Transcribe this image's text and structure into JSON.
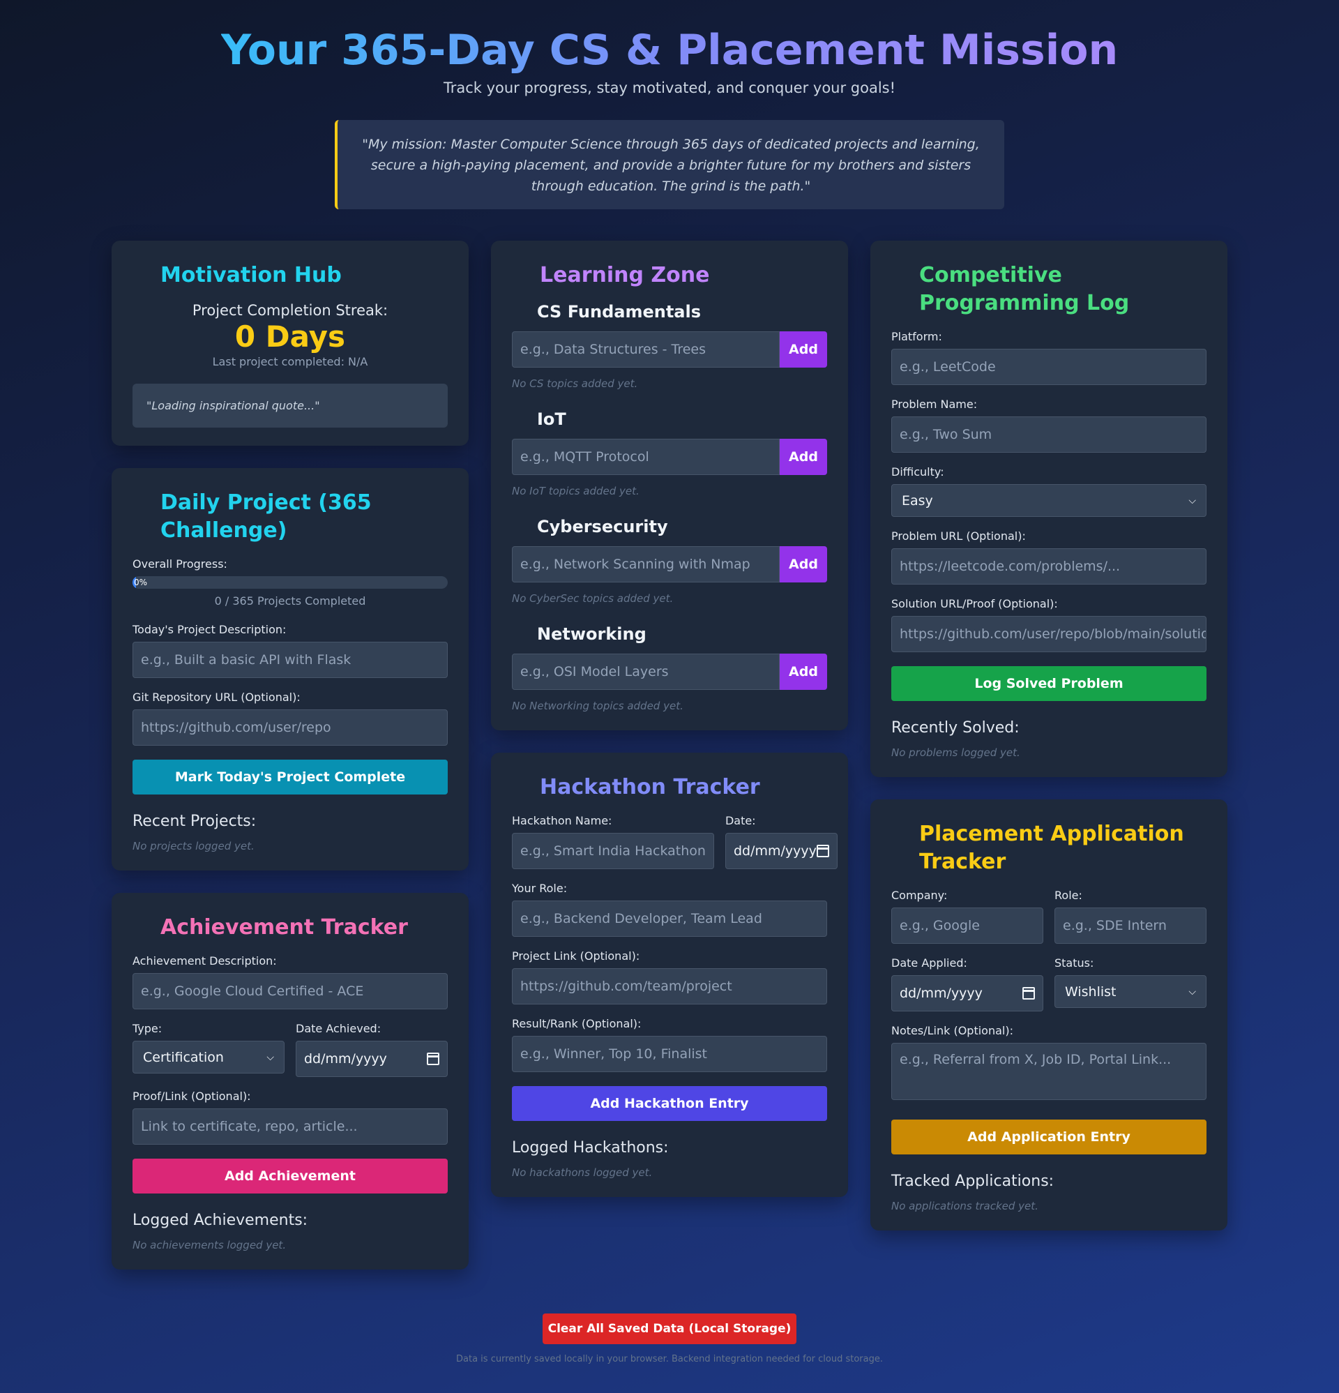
{
  "header": {
    "title": "Your 365-Day CS & Placement Mission",
    "subtitle": "Track your progress, stay motivated, and conquer your goals!",
    "mission": "\"My mission: Master Computer Science through 365 days of dedicated projects and learning, secure a high-paying placement, and provide a brighter future for my brothers and sisters through education. The grind is the path.\""
  },
  "motivation": {
    "title": "Motivation Hub",
    "streak_label": "Project Completion Streak:",
    "streak_value": "0 Days",
    "last_completed": "Last project completed: N/A",
    "quote": "\"Loading inspirational quote...\""
  },
  "daily": {
    "title": "Daily Project (365 Challenge)",
    "progress_label": "Overall Progress:",
    "progress_text": "0%",
    "progress_fraction": 0,
    "progress_caption": "0 / 365 Projects Completed",
    "desc_label": "Today's Project Description:",
    "desc_placeholder": "e.g., Built a basic API with Flask",
    "git_label": "Git Repository URL (Optional):",
    "git_placeholder": "https://github.com/user/repo",
    "button": "Mark Today's Project Complete",
    "recent_heading": "Recent Projects:",
    "recent_empty": "No projects logged yet.",
    "button_color": "#0891b2"
  },
  "achievement": {
    "title": "Achievement Tracker",
    "desc_label": "Achievement Description:",
    "desc_placeholder": "e.g., Google Cloud Certified - ACE",
    "type_label": "Type:",
    "type_value": "Certification",
    "date_label": "Date Achieved:",
    "date_placeholder": "dd/mm/yyyy",
    "proof_label": "Proof/Link (Optional):",
    "proof_placeholder": "Link to certificate, repo, article...",
    "button": "Add Achievement",
    "logged_heading": "Logged Achievements:",
    "logged_empty": "No achievements logged yet.",
    "button_color": "#db2777"
  },
  "learning": {
    "title": "Learning Zone",
    "add_label": "Add",
    "topics": [
      {
        "title": "CS Fundamentals",
        "placeholder": "e.g., Data Structures - Trees",
        "empty": "No CS topics added yet."
      },
      {
        "title": "IoT",
        "placeholder": "e.g., MQTT Protocol",
        "empty": "No IoT topics added yet."
      },
      {
        "title": "Cybersecurity",
        "placeholder": "e.g., Network Scanning with Nmap",
        "empty": "No CyberSec topics added yet."
      },
      {
        "title": "Networking",
        "placeholder": "e.g., OSI Model Layers",
        "empty": "No Networking topics added yet."
      }
    ]
  },
  "hackathon": {
    "title": "Hackathon Tracker",
    "name_label": "Hackathon Name:",
    "name_placeholder": "e.g., Smart India Hackathon",
    "date_label": "Date:",
    "date_placeholder": "dd/mm/yyyy",
    "role_label": "Your Role:",
    "role_placeholder": "e.g., Backend Developer, Team Lead",
    "link_label": "Project Link (Optional):",
    "link_placeholder": "https://github.com/team/project",
    "result_label": "Result/Rank (Optional):",
    "result_placeholder": "e.g., Winner, Top 10, Finalist",
    "button": "Add Hackathon Entry",
    "logged_heading": "Logged Hackathons:",
    "logged_empty": "No hackathons logged yet.",
    "button_color": "#4f46e5"
  },
  "cp": {
    "title": "Competitive Programming Log",
    "platform_label": "Platform:",
    "platform_placeholder": "e.g., LeetCode",
    "problem_label": "Problem Name:",
    "problem_placeholder": "e.g., Two Sum",
    "difficulty_label": "Difficulty:",
    "difficulty_value": "Easy",
    "url_label": "Problem URL (Optional):",
    "url_placeholder": "https://leetcode.com/problems/...",
    "solution_label": "Solution URL/Proof (Optional):",
    "solution_placeholder": "https://github.com/user/repo/blob/main/solution",
    "button": "Log Solved Problem",
    "recent_heading": "Recently Solved:",
    "recent_empty": "No problems logged yet.",
    "button_color": "#16a34a"
  },
  "placement": {
    "title": "Placement Application Tracker",
    "company_label": "Company:",
    "company_placeholder": "e.g., Google",
    "role_label": "Role:",
    "role_placeholder": "e.g., SDE Intern",
    "date_label": "Date Applied:",
    "date_placeholder": "dd/mm/yyyy",
    "status_label": "Status:",
    "status_value": "Wishlist",
    "notes_label": "Notes/Link (Optional):",
    "notes_placeholder": "e.g., Referral from X, Job ID, Portal Link...",
    "button": "Add Application Entry",
    "tracked_heading": "Tracked Applications:",
    "tracked_empty": "No applications tracked yet.",
    "button_color": "#ca8a04"
  },
  "footer": {
    "clear_button": "Clear All Saved Data (Local Storage)",
    "note": "Data is currently saved locally in your browser. Backend integration needed for cloud storage."
  }
}
